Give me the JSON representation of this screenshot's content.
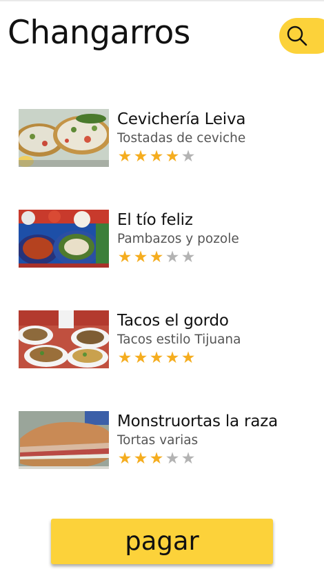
{
  "app": {
    "title": "Changarros",
    "search_icon": "search-icon",
    "accent_color": "#fcd23a",
    "star_color": "#f5ad1f",
    "star_empty_color": "#b3b3b3"
  },
  "items": [
    {
      "name": "Cevichería Leiva",
      "subtitle": "Tostadas de ceviche",
      "rating": 4,
      "max_rating": 5
    },
    {
      "name": "El tío feliz",
      "subtitle": "Pambazos y pozole",
      "rating": 3,
      "max_rating": 5
    },
    {
      "name": "Tacos el gordo",
      "subtitle": "Tacos estilo Tijuana",
      "rating": 5,
      "max_rating": 5
    },
    {
      "name": "Monstruortas la raza",
      "subtitle": "Tortas varias",
      "rating": 3,
      "max_rating": 5
    }
  ],
  "footer": {
    "pay_label": "pagar"
  }
}
